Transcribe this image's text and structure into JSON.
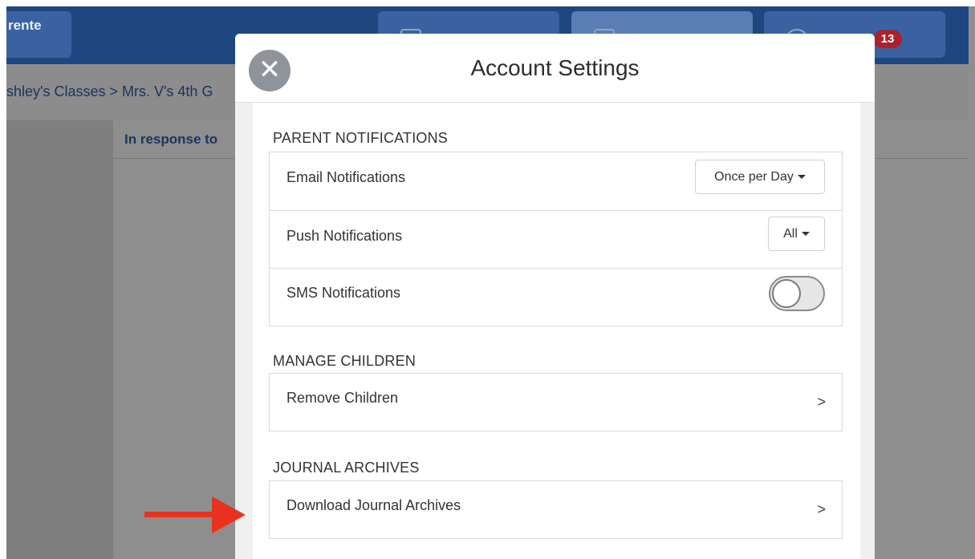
{
  "app": {
    "topbar": {
      "brand_label": "rente",
      "inbox_badge": "13"
    },
    "breadcrumb": "shley's Classes > Mrs. V's 4th G",
    "content_header": "In response to"
  },
  "modal": {
    "title": "Account Settings",
    "close_icon": "close-icon",
    "sections": {
      "parent_notifications": {
        "title": "PARENT NOTIFICATIONS",
        "email": {
          "label": "Email Notifications",
          "value": "Once per Day"
        },
        "push": {
          "label": "Push Notifications",
          "value": "All"
        },
        "sms": {
          "label": "SMS Notifications",
          "enabled": false
        }
      },
      "manage_children": {
        "title": "MANAGE CHILDREN",
        "remove": {
          "label": "Remove Children",
          "chevron": ">"
        }
      },
      "journal_archives": {
        "title": "JOURNAL ARCHIVES",
        "download": {
          "label": "Download Journal Archives",
          "chevron": ">"
        }
      }
    }
  },
  "colors": {
    "topbar": "#1f477f",
    "badge": "#a8232c",
    "overlay": "#8e8e8e",
    "annotation_arrow": "#e8321e"
  }
}
